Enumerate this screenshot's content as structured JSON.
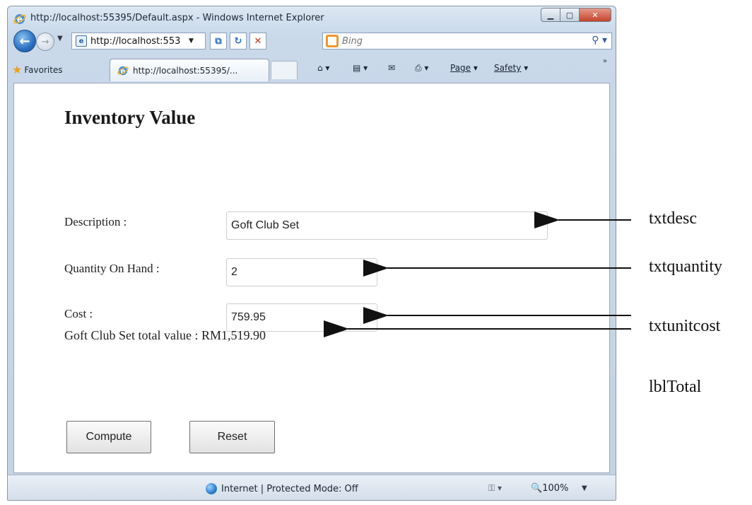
{
  "window": {
    "title": "http://localhost:55395/Default.aspx - Windows Internet Explorer",
    "address": "http://localhost:553",
    "search_placeholder": "Bing",
    "favorites_label": "Favorites",
    "tab_label": "http://localhost:55395/...",
    "page_menu": "Page",
    "safety_menu": "Safety",
    "status_zone": "Internet | Protected Mode: Off",
    "zoom": "100%"
  },
  "page": {
    "heading": "Inventory Value",
    "description_label": "Description :",
    "description_value": "Goft Club Set",
    "quantity_label": "Quantity On Hand :",
    "quantity_value": "2",
    "cost_label": "Cost :",
    "cost_value": "759.95",
    "total_text": "Goft Club Set total value : RM1,519.90",
    "compute_label": "Compute",
    "reset_label": "Reset"
  },
  "annotations": {
    "txtdesc": "txtdesc",
    "txtquantity": "txtquantity",
    "txtunitcost": "txtunitcost",
    "lblTotal": "lblTotal"
  },
  "icons": [
    "ie-logo-icon",
    "back-icon",
    "forward-icon",
    "refresh-icon",
    "stop-icon",
    "search-icon",
    "star-icon",
    "home-icon",
    "feeds-icon",
    "mail-icon",
    "print-icon",
    "globe-icon"
  ]
}
